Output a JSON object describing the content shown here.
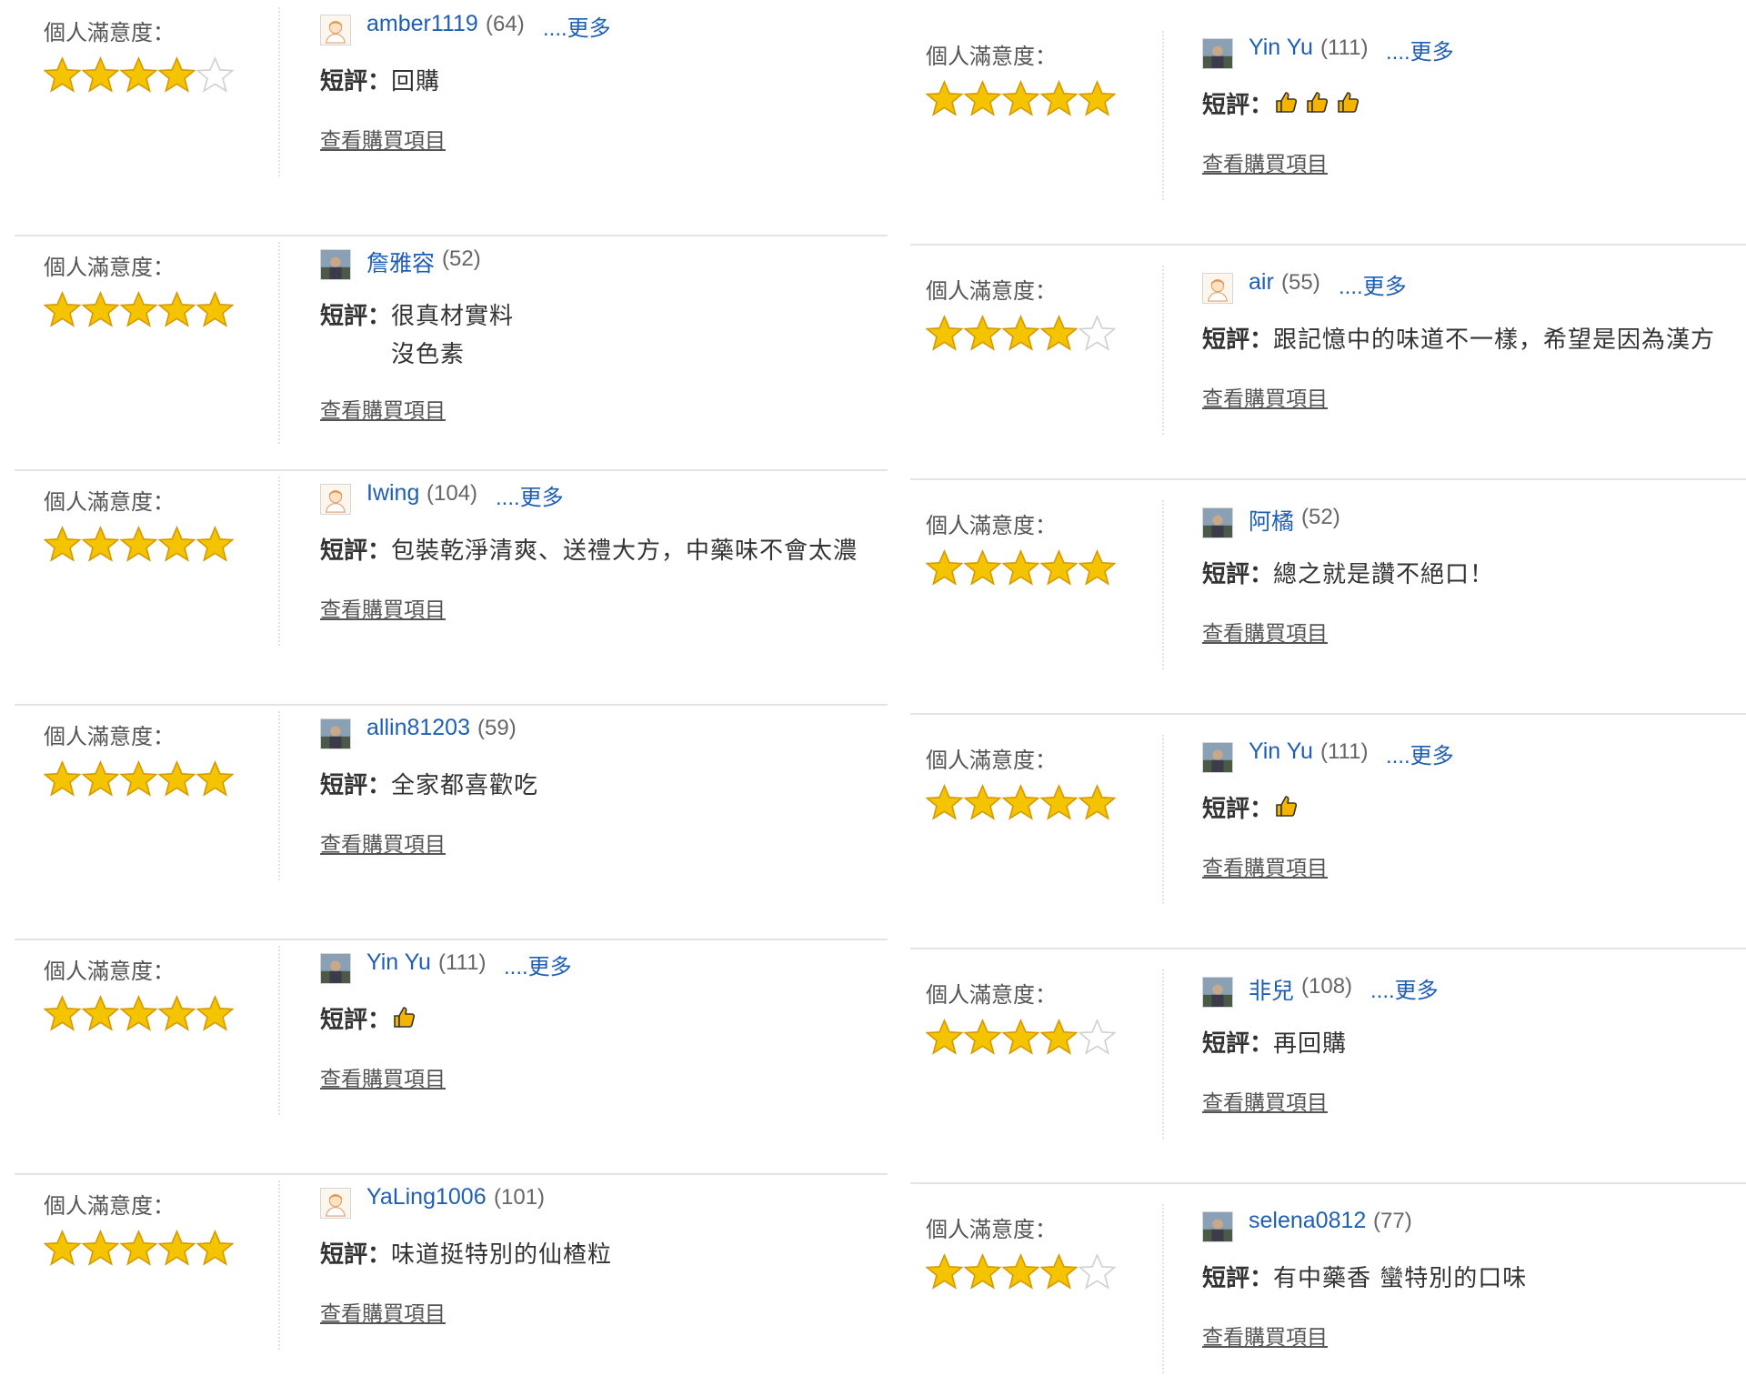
{
  "labels": {
    "satisfaction": "個人滿意度：",
    "comment": "短評：",
    "view_items": "查看購買項目",
    "more": "....更多"
  },
  "colors": {
    "link": "#1f5fb3",
    "star": "#f5c400",
    "star_empty": "#d0d0d0",
    "thumb": "#f5b400"
  },
  "left_reviews": [
    {
      "user": "amber1119",
      "count": "(64)",
      "has_more": true,
      "avatar": "default-avatar-icon",
      "rating": 4,
      "comment": "回購"
    },
    {
      "user": "詹雅容",
      "count": "(52)",
      "has_more": false,
      "avatar": "photo-avatar-icon",
      "rating": 5,
      "comment": "很真材實料",
      "comment_line2": "沒色素"
    },
    {
      "user": "Iwing",
      "count": "(104)",
      "has_more": true,
      "avatar": "default-avatar-icon",
      "rating": 5,
      "comment": "包裝乾淨清爽、送禮大方，中藥味不會太濃"
    },
    {
      "user": "allin81203",
      "count": "(59)",
      "has_more": false,
      "avatar": "photo-avatar-icon",
      "rating": 5,
      "comment": "全家都喜歡吃"
    },
    {
      "user": "Yin Yu",
      "count": "(111)",
      "has_more": true,
      "avatar": "photo-avatar-icon",
      "rating": 5,
      "comment": "",
      "thumbs": 1
    },
    {
      "user": "YaLing1006",
      "count": "(101)",
      "has_more": false,
      "avatar": "default-avatar-icon",
      "rating": 5,
      "comment": "味道挺特別的仙楂粒"
    }
  ],
  "right_reviews": [
    {
      "user": "Yin Yu",
      "count": "(111)",
      "has_more": true,
      "avatar": "photo-avatar-icon",
      "rating": 5,
      "comment": "",
      "thumbs": 3
    },
    {
      "user": "air",
      "count": "(55)",
      "has_more": true,
      "avatar": "default-avatar-icon",
      "rating": 4,
      "comment": "跟記憶中的味道不一樣，希望是因為漢方"
    },
    {
      "user": "阿橘",
      "count": "(52)",
      "has_more": false,
      "avatar": "photo-avatar-icon",
      "rating": 5,
      "comment": "總之就是讚不絕口！"
    },
    {
      "user": "Yin Yu",
      "count": "(111)",
      "has_more": true,
      "avatar": "photo-avatar-icon",
      "rating": 5,
      "comment": "",
      "thumbs": 1
    },
    {
      "user": "非兒",
      "count": "(108)",
      "has_more": true,
      "avatar": "photo-avatar-icon",
      "rating": 4,
      "comment": "再回購"
    },
    {
      "user": "selena0812",
      "count": "(77)",
      "has_more": false,
      "avatar": "photo-avatar-icon",
      "rating": 4,
      "comment": "有中藥香 蠻特別的口味"
    }
  ]
}
